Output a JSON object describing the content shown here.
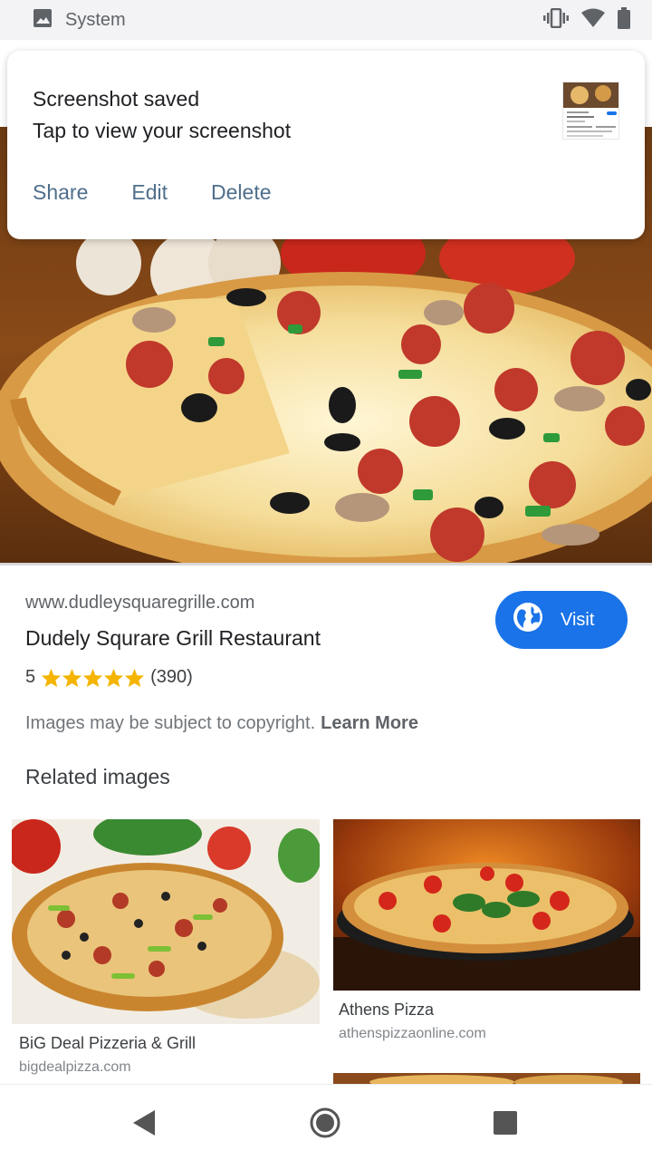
{
  "status_bar": {
    "label": "System",
    "icons": [
      "image-icon",
      "vibrate-icon",
      "wifi-icon",
      "battery-icon"
    ]
  },
  "notification": {
    "title": "Screenshot saved",
    "text": "Tap to view your screenshot",
    "actions": [
      "Share",
      "Edit",
      "Delete"
    ],
    "thumbnail": "screenshot-thumbnail"
  },
  "result": {
    "url": "www.dudleysquaregrille.com",
    "title": "Dudely Squrare Grill Restaurant",
    "rating": "5",
    "stars": 5,
    "reviews": "(390)",
    "visit_label": "Visit",
    "copyright": "Images may be subject to copyright.",
    "learn_more": "Learn More",
    "related_title": "Related images"
  },
  "related": [
    {
      "title": "BiG Deal Pizzeria & Grill",
      "site": "bigdealpizza.com"
    },
    {
      "title": "Athens Pizza",
      "site": "athenspizzaonline.com"
    }
  ],
  "nav": [
    "back-button",
    "home-button",
    "recents-button"
  ],
  "colors": {
    "accent": "#1a73e8",
    "star": "#f4b400",
    "action": "#4f6f8c"
  }
}
